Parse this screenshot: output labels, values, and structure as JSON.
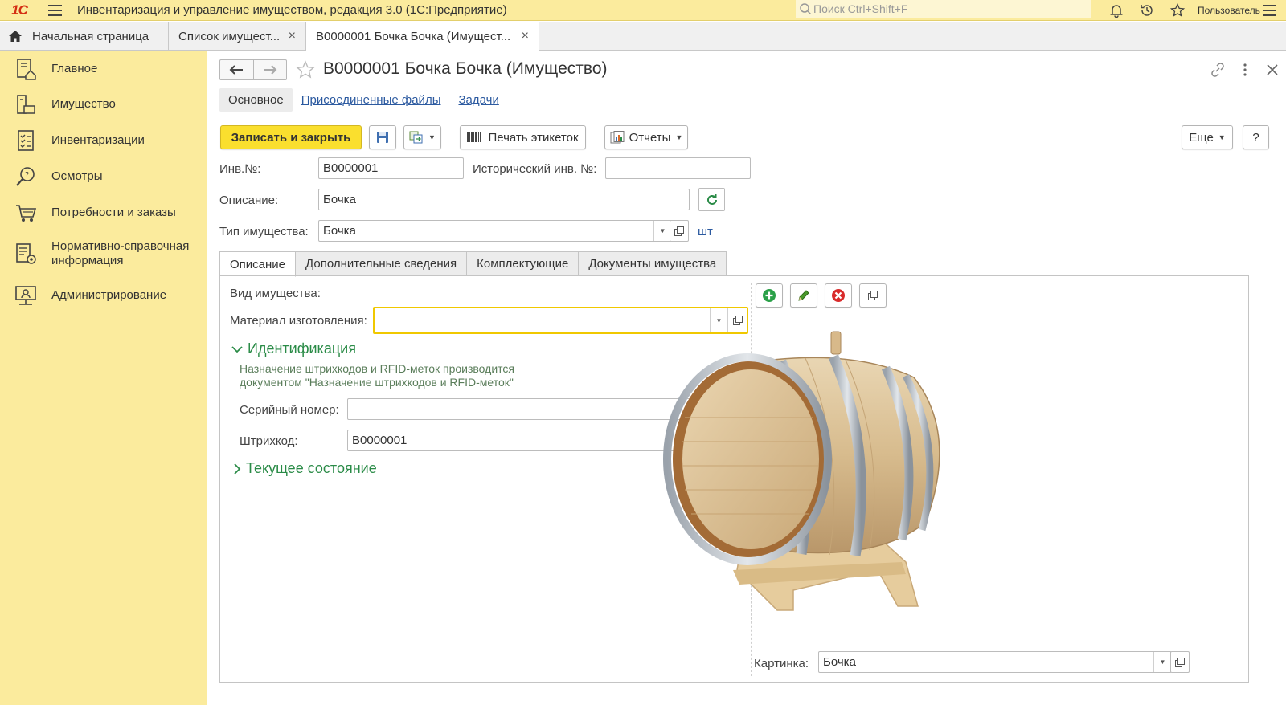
{
  "app": {
    "logo": "1С",
    "title": "Инвентаризация и управление имуществом, редакция 3.0  (1С:Предприятие)",
    "search_placeholder": "Поиск Ctrl+Shift+F",
    "user": "Пользователь"
  },
  "window_tabs": [
    {
      "label": "Начальная страница"
    },
    {
      "label": "Список имущест...",
      "close": "×"
    },
    {
      "label": "В0000001 Бочка Бочка (Имущест...",
      "close": "×"
    }
  ],
  "sidebar": {
    "items": [
      {
        "label": "Главное",
        "icon": "home-doc-icon"
      },
      {
        "label": "Имущество",
        "icon": "asset-icon"
      },
      {
        "label": "Инвентаризации",
        "icon": "checklist-icon"
      },
      {
        "label": "Осмотры",
        "icon": "magnifier-question-icon"
      },
      {
        "label": "Потребности и заказы",
        "icon": "cart-icon"
      },
      {
        "label": "Нормативно-справочная информация",
        "icon": "reference-doc-icon"
      },
      {
        "label": "Администрирование",
        "icon": "monitor-icon"
      }
    ]
  },
  "form": {
    "title": "В0000001 Бочка Бочка (Имущество)",
    "subtabs": [
      "Основное",
      "Присоединенные файлы",
      "Задачи"
    ],
    "toolbar": {
      "save_close": "Записать и закрыть",
      "print_labels": "Печать этикеток",
      "reports": "Отчеты",
      "more": "Еще",
      "help": "?"
    },
    "fields": {
      "inv_label": "Инв.№:",
      "inv_value": "В0000001",
      "hist_label": "Исторический инв. №:",
      "hist_value": "",
      "desc_label": "Описание:",
      "desc_value": "Бочка",
      "type_label": "Тип имущества:",
      "type_value": "Бочка",
      "unit": "шт"
    },
    "inner_tabs": [
      "Описание",
      "Дополнительные сведения",
      "Комплектующие",
      "Документы имущества"
    ],
    "description_tab": {
      "kind_label": "Вид имущества:",
      "material_label": "Материал изготовления:",
      "material_value": "",
      "ident_header": "Идентификация",
      "ident_note_1": "Назначение штрихкодов и RFID-меток производится",
      "ident_note_2": "документом \"Назначение штрихкодов и RFID-меток\"",
      "serial_label": "Серийный номер:",
      "serial_value": "",
      "barcode_label": "Штрихкод:",
      "barcode_value": "В0000001",
      "state_header": "Текущее состояние",
      "picture_label": "Картинка:",
      "picture_value": "Бочка"
    }
  },
  "colors": {
    "sidebar_bg": "#fbeb9d",
    "primary_button": "#fadf2e",
    "link": "#2c5aa0",
    "group_header": "#2a8b47"
  }
}
